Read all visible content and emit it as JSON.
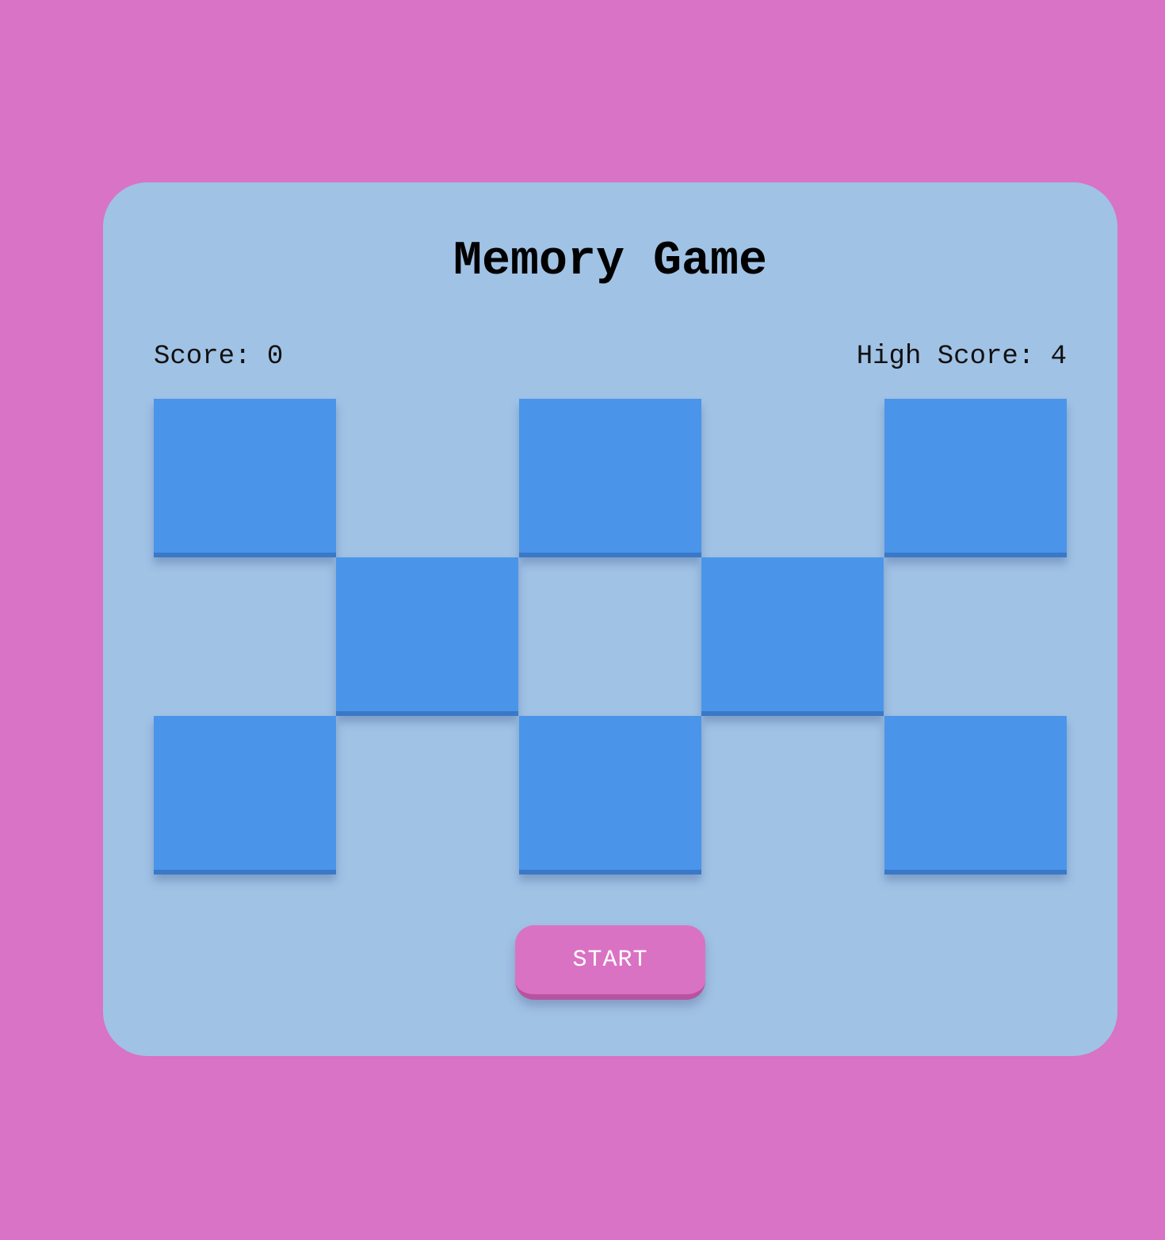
{
  "game": {
    "title": "Memory Game",
    "score_label": "Score: 0",
    "high_score_label": "High Score: 4",
    "score": 0,
    "high_score": 4,
    "start_label": "START"
  },
  "board": {
    "columns": 5,
    "rows": 3,
    "tiles": [
      {
        "id": 1,
        "state": "face-down"
      },
      {
        "id": 2,
        "state": "face-down"
      },
      {
        "id": 3,
        "state": "face-down"
      },
      {
        "id": 4,
        "state": "face-down"
      },
      {
        "id": 5,
        "state": "face-down"
      },
      {
        "id": 6,
        "state": "face-down"
      },
      {
        "id": 7,
        "state": "face-down"
      },
      {
        "id": 8,
        "state": "face-down"
      }
    ]
  },
  "colors": {
    "background": "#d873c5",
    "panel": "#a0c2e5",
    "tile": "#4a95ea",
    "button": "#da72c4"
  }
}
